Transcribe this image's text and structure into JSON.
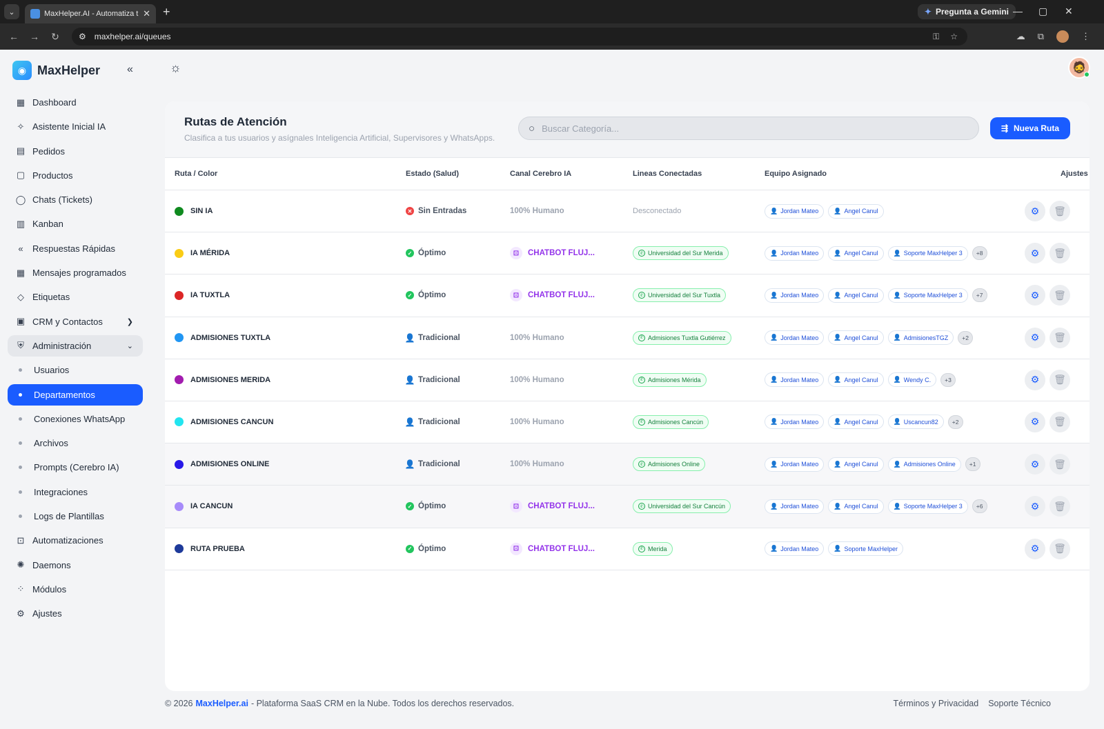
{
  "browser": {
    "tab_title": "MaxHelper.AI - Automatiza tu a",
    "gemini": "Pregunta a Gemini",
    "url": "maxhelper.ai/queues"
  },
  "sidebar": {
    "brand": "MaxHelper",
    "items": [
      {
        "label": "Dashboard",
        "icon": "grid-icon"
      },
      {
        "label": "Asistente Inicial IA",
        "icon": "sparkle-icon"
      },
      {
        "label": "Pedidos",
        "icon": "receipt-icon"
      },
      {
        "label": "Productos",
        "icon": "bag-icon"
      },
      {
        "label": "Chats (Tickets)",
        "icon": "whatsapp-icon"
      },
      {
        "label": "Kanban",
        "icon": "kanban-icon"
      },
      {
        "label": "Respuestas Rápidas",
        "icon": "reply-all-icon"
      },
      {
        "label": "Mensajes programados",
        "icon": "calendar-icon"
      },
      {
        "label": "Etiquetas",
        "icon": "tag-icon"
      },
      {
        "label": "CRM y Contactos",
        "icon": "contacts-icon"
      },
      {
        "label": "Administración",
        "icon": "shield-icon"
      }
    ],
    "admin_sub": [
      "Usuarios",
      "Departamentos",
      "Conexiones WhatsApp",
      "Archivos",
      "Prompts (Cerebro IA)",
      "Integraciones",
      "Logs de Plantillas"
    ],
    "bottom_items": [
      {
        "label": "Automatizaciones",
        "icon": "robot-icon"
      },
      {
        "label": "Daemons",
        "icon": "daemon-icon"
      },
      {
        "label": "Módulos",
        "icon": "modules-icon"
      },
      {
        "label": "Ajustes",
        "icon": "settings-icon"
      }
    ]
  },
  "card": {
    "title": "Rutas de Atención",
    "subtitle": "Clasifica a tus usuarios y asígnales Inteligencia Artificial, Supervisores y WhatsApps.",
    "search_placeholder": "Buscar Categoría...",
    "new_button": "Nueva Ruta",
    "columns": {
      "ruta": "Ruta / Color",
      "estado": "Estado (Salud)",
      "canal": "Canal Cerebro IA",
      "lineas": "Lineas Conectadas",
      "equipo": "Equipo Asignado",
      "ajustes": "Ajustes"
    }
  },
  "rows": [
    {
      "name": "SIN IA",
      "color": "#0f8a1f",
      "state": "Sin Entradas",
      "state_type": "bad",
      "canal": "100% Humano",
      "bot": false,
      "line": "Desconectado",
      "line_connected": false,
      "team": [
        "Jordan Mateo",
        "Angel Canul"
      ],
      "more": ""
    },
    {
      "name": "IA MÉRIDA",
      "color": "#facc15",
      "state": "Óptimo",
      "state_type": "ok",
      "canal": "CHATBOT FLUJ...",
      "bot": true,
      "line": "Universidad del Sur Merida",
      "line_connected": true,
      "team": [
        "Jordan Mateo",
        "Angel Canul",
        "Soporte MaxHelper 3"
      ],
      "more": "+8"
    },
    {
      "name": "IA TUXTLA",
      "color": "#dc2626",
      "state": "Óptimo",
      "state_type": "ok",
      "canal": "CHATBOT FLUJ...",
      "bot": true,
      "line": "Universidad del Sur Tuxtla",
      "line_connected": true,
      "team": [
        "Jordan Mateo",
        "Angel Canul",
        "Soporte MaxHelper 3"
      ],
      "more": "+7"
    },
    {
      "name": "ADMISIONES TUXTLA",
      "color": "#2196f3",
      "state": "Tradicional",
      "state_type": "trad",
      "canal": "100% Humano",
      "bot": false,
      "line": "Admisiones Tuxtla Gutiérrez",
      "line_connected": true,
      "team": [
        "Jordan Mateo",
        "Angel Canul",
        "AdmisionesTGZ"
      ],
      "more": "+2"
    },
    {
      "name": "ADMISIONES MERIDA",
      "color": "#a21caf",
      "state": "Tradicional",
      "state_type": "trad",
      "canal": "100% Humano",
      "bot": false,
      "line": "Admisiones Mérida",
      "line_connected": true,
      "team": [
        "Jordan Mateo",
        "Angel Canul",
        "Wendy C."
      ],
      "more": "+3"
    },
    {
      "name": "ADMISIONES CANCUN",
      "color": "#22e5f0",
      "state": "Tradicional",
      "state_type": "trad",
      "canal": "100% Humano",
      "bot": false,
      "line": "Admisiones Cancún",
      "line_connected": true,
      "team": [
        "Jordan Mateo",
        "Angel Canul",
        "Uscancun82"
      ],
      "more": "+2"
    },
    {
      "name": "ADMISIONES ONLINE",
      "color": "#2818e8",
      "state": "Tradicional",
      "state_type": "trad",
      "canal": "100% Humano",
      "bot": false,
      "line": "Admisiones Online",
      "line_connected": true,
      "team": [
        "Jordan Mateo",
        "Angel Canul",
        "Admisiones Online"
      ],
      "more": "+1"
    },
    {
      "name": "IA CANCUN",
      "color": "#a78bfa",
      "state": "Óptimo",
      "state_type": "ok",
      "canal": "CHATBOT FLUJ...",
      "bot": true,
      "line": "Universidad del Sur Cancún",
      "line_connected": true,
      "team": [
        "Jordan Mateo",
        "Angel Canul",
        "Soporte MaxHelper 3"
      ],
      "more": "+6"
    },
    {
      "name": "RUTA PRUEBA",
      "color": "#1e3a9a",
      "state": "Óptimo",
      "state_type": "ok",
      "canal": "CHATBOT FLUJ...",
      "bot": true,
      "line": "Merida",
      "line_connected": true,
      "team": [
        "Jordan Mateo",
        "Soporte MaxHelper"
      ],
      "more": ""
    }
  ],
  "footer": {
    "prefix": "© 2026",
    "brand": "MaxHelper.ai",
    "text": "- Plataforma SaaS CRM en la Nube. Todos los derechos reservados.",
    "terms": "Términos y Privacidad",
    "support": "Soporte Técnico"
  }
}
